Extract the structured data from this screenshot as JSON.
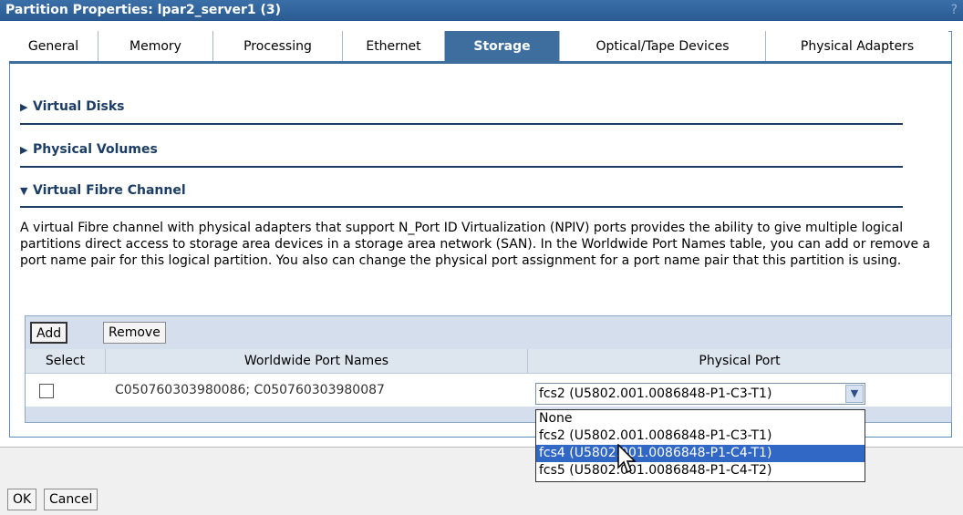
{
  "window": {
    "title": "Partition Properties: lpar2_server1 (3)",
    "help": "?"
  },
  "tabs": [
    {
      "label": "General"
    },
    {
      "label": "Memory"
    },
    {
      "label": "Processing"
    },
    {
      "label": "Ethernet"
    },
    {
      "label": "Storage"
    },
    {
      "label": "Optical/Tape Devices"
    },
    {
      "label": "Physical Adapters"
    }
  ],
  "sections": {
    "virtual_disks": {
      "label": "Virtual Disks"
    },
    "physical_volumes": {
      "label": "Physical Volumes"
    },
    "virtual_fibre": {
      "label": "Virtual Fibre Channel"
    }
  },
  "description": "A virtual Fibre channel with physical adapters that support N_Port ID Virtualization (NPIV) ports provides the ability to give multiple logical partitions direct access to storage area devices in a storage area network (SAN). In the Worldwide Port Names table, you can add or remove a port name pair for this logical partition. You also can change the physical port assignment for a port name pair that this partition is using.",
  "table": {
    "add_label": "Add",
    "remove_label": "Remove",
    "headers": {
      "select": "Select",
      "wwpn": "Worldwide Port Names",
      "port": "Physical Port"
    },
    "rows": [
      {
        "wwpn": "C050760303980086; C050760303980087",
        "port": "fcs2 (U5802.001.0086848-P1-C3-T1)"
      }
    ]
  },
  "dropdown": {
    "options": [
      "None",
      "fcs2 (U5802.001.0086848-P1-C3-T1)",
      "fcs4 (U5802.001.0086848-P1-C4-T1)",
      "fcs5 (U5802.001.0086848-P1-C4-T2)"
    ],
    "highlighted_index": 2
  },
  "footer": {
    "ok_label": "OK",
    "cancel_label": "Cancel"
  }
}
